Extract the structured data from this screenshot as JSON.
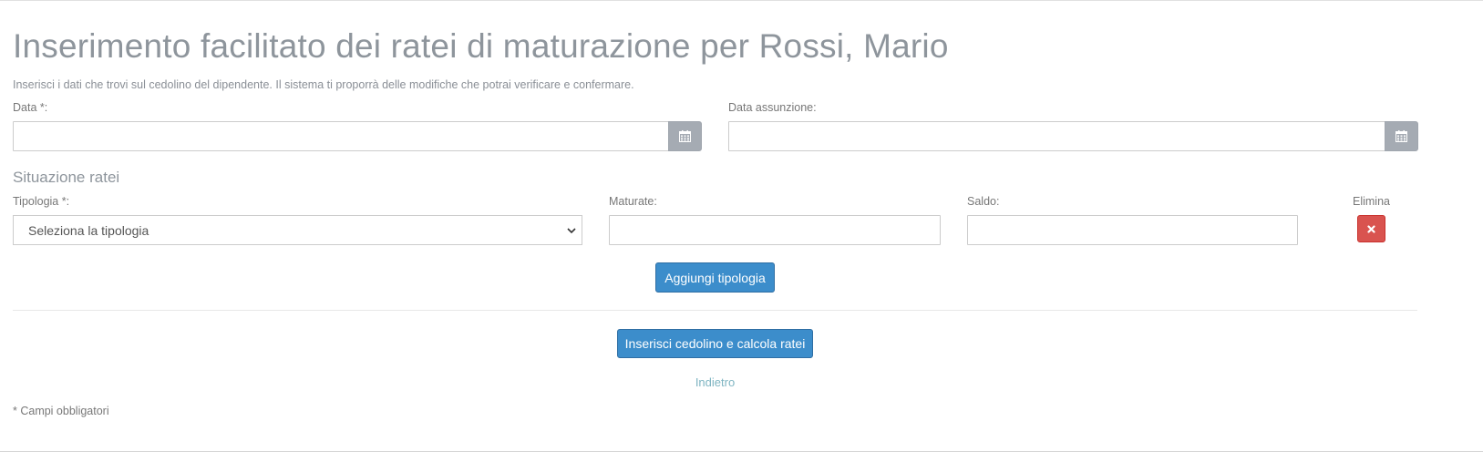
{
  "header": {
    "title": "Inserimento facilitato dei ratei di maturazione per Rossi, Mario",
    "subtitle": "Inserisci i dati che trovi sul cedolino del dipendente. Il sistema ti proporrà delle modifiche che potrai verificare e confermare."
  },
  "form": {
    "data_label": "Data *:",
    "data_value": "",
    "data_assunzione_label": "Data assunzione:",
    "data_assunzione_value": "",
    "calendar_icon": "calendar-icon"
  },
  "ratei": {
    "section_title": "Situazione ratei",
    "tipologia_label": "Tipologia *:",
    "tipologia_selected": "Seleziona la tipologia",
    "maturate_label": "Maturate:",
    "maturate_value": "",
    "saldo_label": "Saldo:",
    "saldo_value": "",
    "elimina_label": "Elimina",
    "add_button_label": "Aggiungi tipologia"
  },
  "actions": {
    "submit_label": "Inserisci cedolino e calcola ratei",
    "back_label": "Indietro"
  },
  "footer": {
    "required_note": "* Campi obbligatori"
  },
  "colors": {
    "primary": "#3c8dcb",
    "danger": "#d9534f",
    "addon": "#a5abb3",
    "link": "#7fb5c2"
  }
}
